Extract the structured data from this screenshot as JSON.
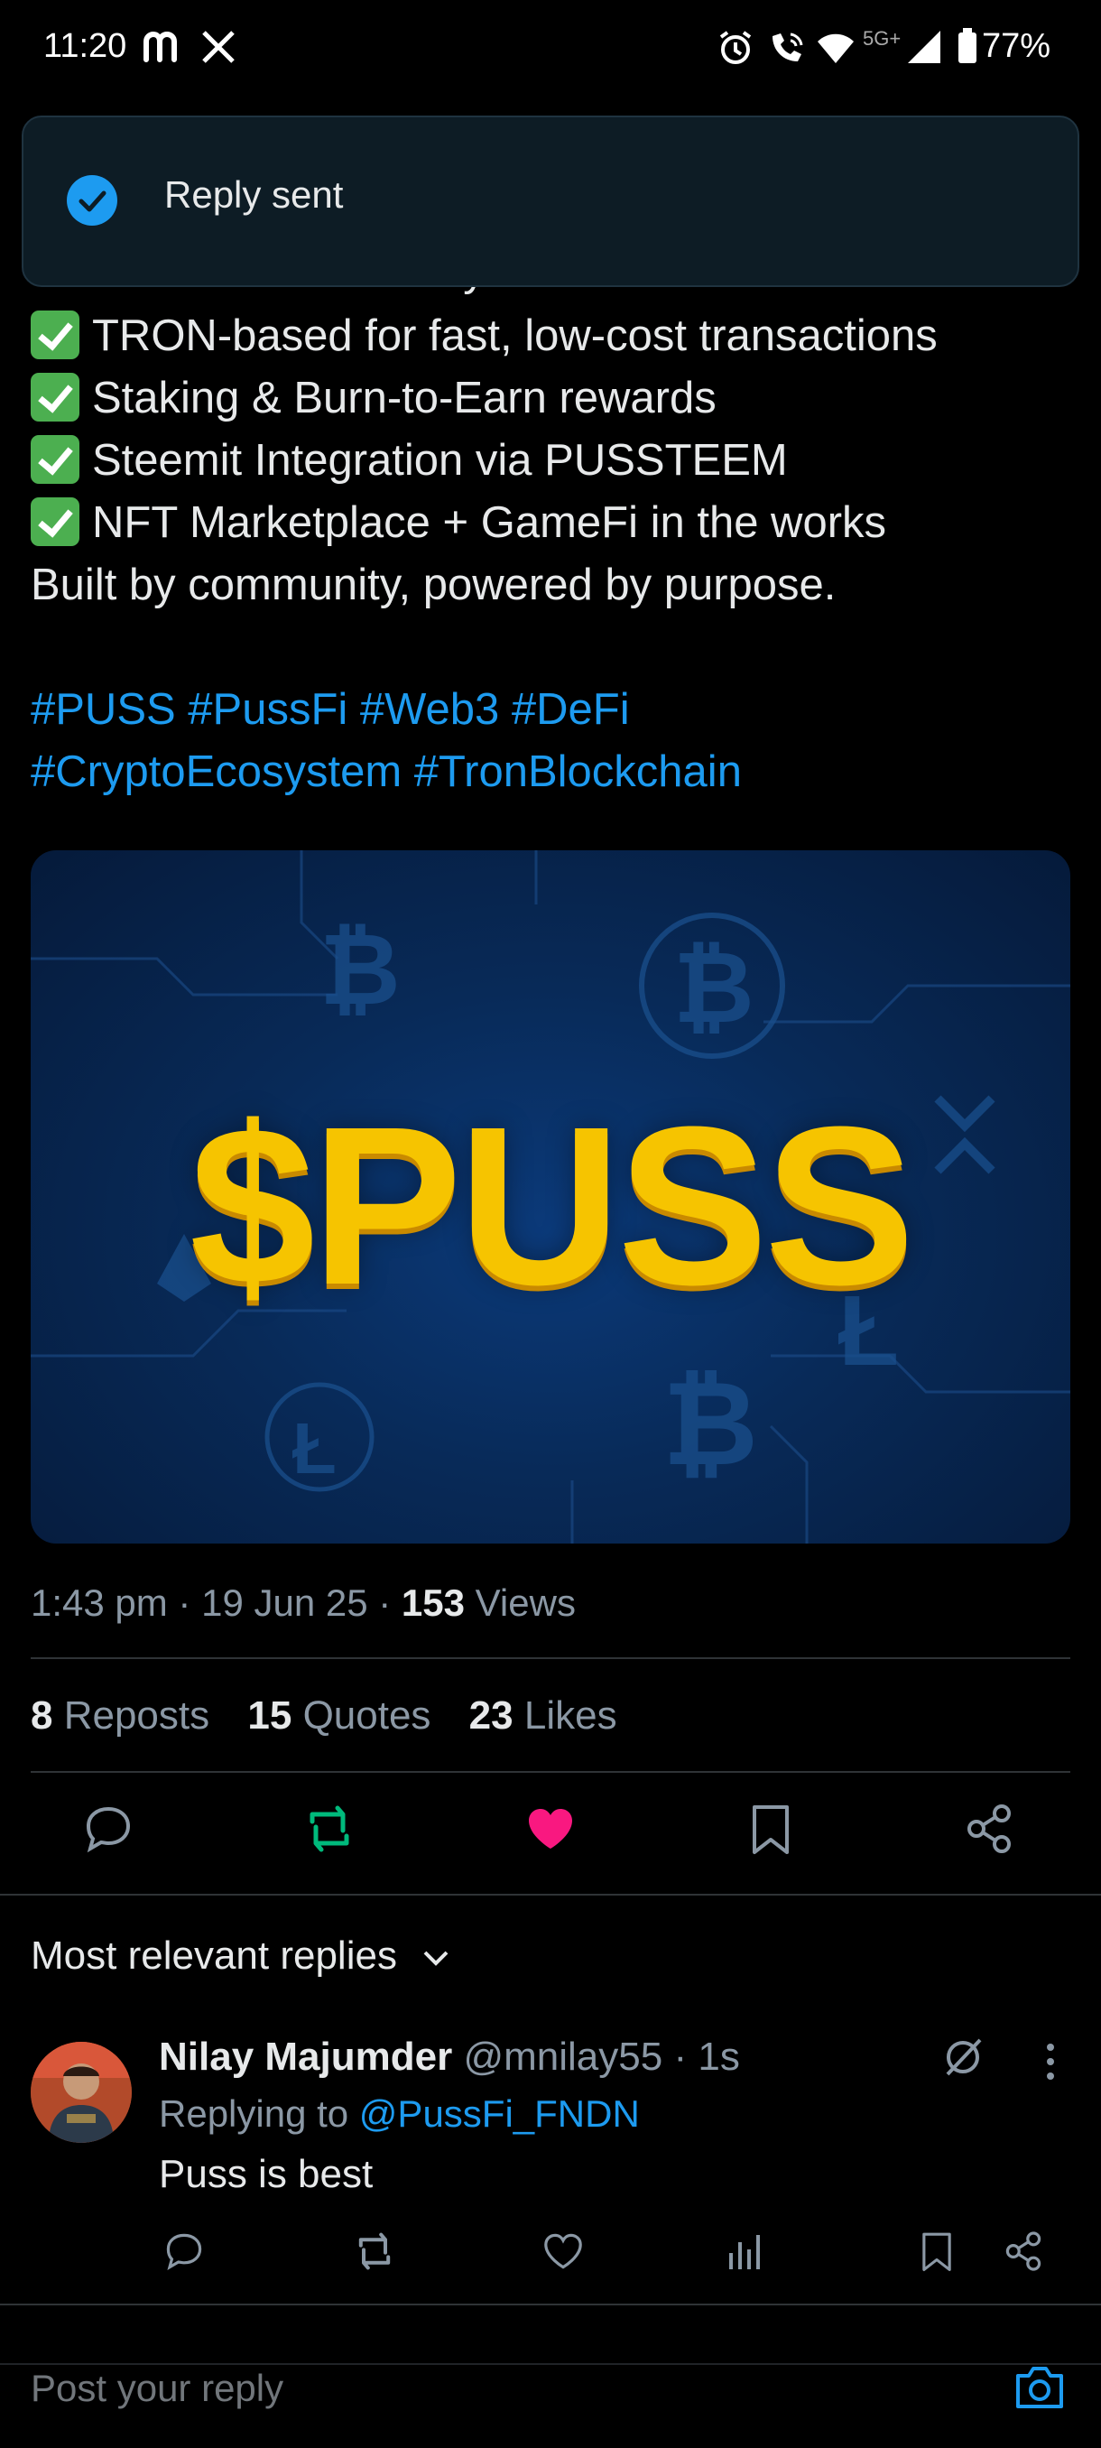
{
  "status_bar": {
    "time": "11:20",
    "network": "5G+",
    "battery": "77%"
  },
  "toast": {
    "text": "Reply sent"
  },
  "tweet": {
    "partial_line": "memes meet real utility.",
    "checklist": [
      "TRON-based for fast, low-cost transactions",
      "Staking & Burn-to-Earn rewards",
      "Steemit Integration via PUSSTEEM",
      "NFT Marketplace + GameFi in the works"
    ],
    "closing": "Built by community, powered by purpose.",
    "hashtags_line1": "#PUSS #PussFi #Web3 #DeFi",
    "hashtags_line2": "#CryptoEcosystem #TronBlockchain",
    "media_text": "$PUSS",
    "time": "1:43 pm",
    "date": "19 Jun 25",
    "views_count": "153",
    "views_label": "Views"
  },
  "stats": {
    "reposts_count": "8",
    "reposts_label": "Reposts",
    "quotes_count": "15",
    "quotes_label": "Quotes",
    "likes_count": "23",
    "likes_label": "Likes"
  },
  "replies_header": "Most relevant replies",
  "reply": {
    "name": "Nilay Majumder",
    "handle": "@mnilay55",
    "age": "1s",
    "replying_prefix": "Replying to",
    "replying_to": "@PussFi_FNDN",
    "text": "Puss is best"
  },
  "composer": {
    "placeholder": "Post your reply"
  },
  "colors": {
    "accent": "#1d9bf0",
    "like": "#f91880",
    "repost": "#00ba7c",
    "coin": "#f6c400"
  }
}
